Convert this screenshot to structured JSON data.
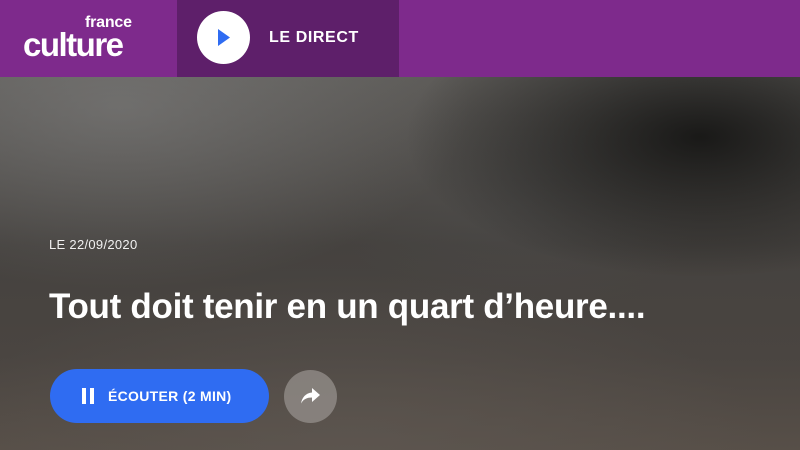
{
  "header": {
    "logo": {
      "line1": "france",
      "line2": "culture"
    },
    "live": {
      "label": "LE DIRECT",
      "icon": "play-icon"
    }
  },
  "episode": {
    "date": "LE 22/09/2020",
    "title": "Tout doit tenir en un quart d’heure....",
    "listen_label": "ÉCOUTER (2 MIN)",
    "listen_icon": "pause-icon",
    "share_icon": "share-icon"
  },
  "colors": {
    "header_bg": "#7e2a8c",
    "live_bg": "#5e1f6a",
    "accent_blue": "#2f6cf2",
    "white": "#ffffff"
  }
}
